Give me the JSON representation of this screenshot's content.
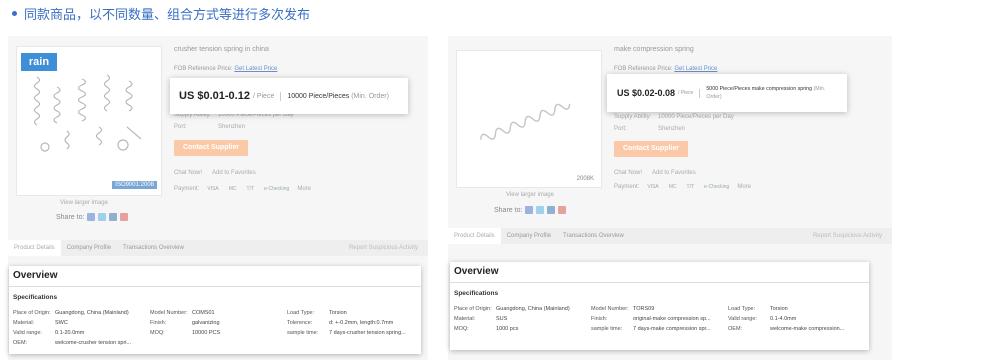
{
  "heading": "同款商品，以不同数量、组合方式等进行多次发布",
  "colors": {
    "accent": "#3a6fc4",
    "contact_button": "#fbc9a7",
    "panel_bg": "#f6f6f6"
  },
  "left_product": {
    "brand_logo": "rain",
    "thumb_code": "ISO9001:2008",
    "view_larger": "View larger image",
    "share_label": "Share to:",
    "title": "crusher tension spring in china",
    "fob_label": "FOB Reference Price:",
    "fob_link": "Get Latest Price",
    "supply_label": "Supply Ability:",
    "supply_value": "10000 Piece/Pieces per Day",
    "port_label": "Port:",
    "port_value": "Shenzhen",
    "contact_button": "Contact Supplier",
    "chat_now": "Chat Now!",
    "add_favorites": "Add to Favorites",
    "payment_label": "Payment:",
    "payment_methods": [
      "VISA",
      "MC",
      "T/T",
      "e-Checking"
    ],
    "more": "More",
    "tabs": [
      "Product Details",
      "Company Profile",
      "Transactions Overview"
    ],
    "report": "Report Suspicious Activity",
    "price_popup": {
      "price": "US $0.01-0.12",
      "unit": "/ Piece",
      "moq": "10000 Piece/Pieces",
      "moq_suffix": "(Min. Order)"
    },
    "overview": {
      "title": "Overview",
      "spec_heading": "Specifications",
      "rows": [
        [
          [
            "Place of Origin:",
            "Guangdong, China (Mainland)"
          ],
          [
            "Model Number:",
            "COMS01"
          ],
          [
            "Load Type:",
            "Torsion"
          ]
        ],
        [
          [
            "Material:",
            "SWC"
          ],
          [
            "Finish:",
            "galvanizing"
          ],
          [
            "Tolerence:",
            "d: +-0.2mm, length:0.7mm"
          ]
        ],
        [
          [
            "Valid range:",
            "0.1-20.0mm"
          ],
          [
            "MOQ:",
            "10000 PCS"
          ],
          [
            "sample time:",
            "7 days-crusher tension spring..."
          ]
        ],
        [
          [
            "OEM:",
            "welcome-crusher tension spri..."
          ],
          [
            "",
            ""
          ],
          [
            "",
            ""
          ]
        ]
      ]
    }
  },
  "right_product": {
    "thumb_code": "2008K",
    "view_larger": "View larger image",
    "share_label": "Share to:",
    "title": "make compression spring",
    "fob_label": "FOB Reference Price:",
    "fob_link": "Get Latest Price",
    "supply_label": "Supply Ability:",
    "supply_value": "10000 Piece/Pieces per Day",
    "port_label": "Port:",
    "port_value": "Shenzhen",
    "contact_button": "Contact Supplier",
    "chat_now": "Chat Now!",
    "add_favorites": "Add to Favorites",
    "payment_label": "Payment:",
    "payment_methods": [
      "VISA",
      "MC",
      "T/T",
      "e-Checking"
    ],
    "more": "More",
    "tabs": [
      "Product Details",
      "Company Profile",
      "Transactions Overview"
    ],
    "report": "Report Suspicious Activity",
    "price_popup": {
      "price": "US $0.02-0.08",
      "unit": "/ Piece",
      "moq": "5000 Piece/Pieces make compression spring",
      "moq_suffix": "(Min. Order)"
    },
    "overview": {
      "title": "Overview",
      "spec_heading": "Specifications",
      "rows": [
        [
          [
            "Place of Origin:",
            "Guangdong, China (Mainland)"
          ],
          [
            "Model Number:",
            "TORS09"
          ],
          [
            "Load Type:",
            "Torsion"
          ]
        ],
        [
          [
            "Material:",
            "SUS"
          ],
          [
            "Finish:",
            "original-make compression sp..."
          ],
          [
            "Valid range:",
            "0.1-4.0mm"
          ]
        ],
        [
          [
            "MOQ:",
            "1000 pcs"
          ],
          [
            "sample time:",
            "7 days-make compression spr..."
          ],
          [
            "OEM:",
            "welcome-make compression..."
          ]
        ]
      ]
    }
  }
}
